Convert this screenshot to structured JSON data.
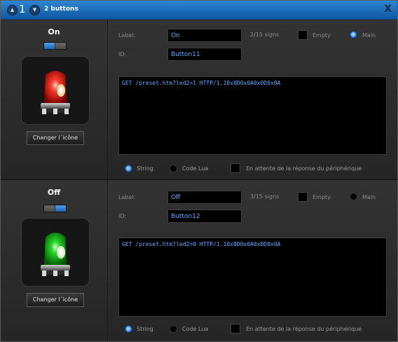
{
  "titlebar": {
    "count": "1",
    "title": "2 buttons",
    "close": "X"
  },
  "buttons": [
    {
      "name": "On",
      "label_caption": "Label:",
      "label_value": "On",
      "signs": "2/15 signs",
      "empty": "Empty",
      "main": "Main",
      "id_caption": "ID:",
      "id_value": "Button11",
      "command": "GET /preset.htm?led2=1 HTTP/1.10x0D0x0A0x0D0x0A",
      "change_icon": "Changer l´icône",
      "opt_string": "String",
      "opt_lua": "Code Lua",
      "opt_wait": "En attente de la réponse du périphérique",
      "light_color": "red",
      "main_selected": true,
      "toggle_active": "left"
    },
    {
      "name": "Off",
      "label_caption": "Label:",
      "label_value": "Off",
      "signs": "3/15 signs",
      "empty": "Empty",
      "main": "Main",
      "id_caption": "ID:",
      "id_value": "Button12",
      "command": "GET /preset.htm?led2=0 HTTP/1.10x0D0x0A0x0D0x0A",
      "change_icon": "Changer l´icône",
      "opt_string": "String",
      "opt_lua": "Code Lua",
      "opt_wait": "En attente de la réponse du périphérique",
      "light_color": "green",
      "main_selected": false,
      "toggle_active": "right"
    }
  ],
  "colors": {
    "accent": "#0d58a4",
    "value_text": "#5aa9ff"
  }
}
